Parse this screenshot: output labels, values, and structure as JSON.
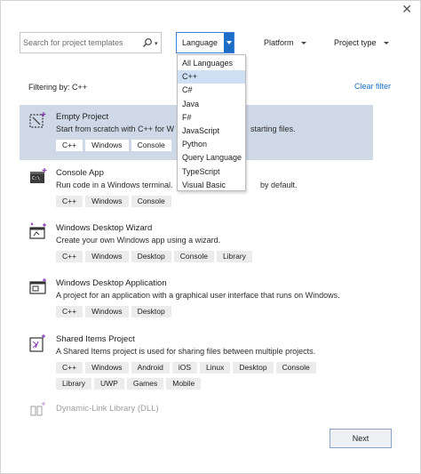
{
  "window": {
    "close_glyph": "✕"
  },
  "search": {
    "placeholder": "Search for project templates",
    "value": ""
  },
  "filters": {
    "language_label": "Language",
    "platform_label": "Platform",
    "project_type_label": "Project type"
  },
  "filtering_text": "Filtering by: C++",
  "clear_filter": "Clear filter",
  "language_menu": {
    "options": [
      "All Languages",
      "C++",
      "C#",
      "Java",
      "F#",
      "JavaScript",
      "Python",
      "Query Language",
      "TypeScript",
      "Visual Basic"
    ],
    "highlighted": "C++"
  },
  "templates": [
    {
      "title": "Empty Project",
      "desc": "Start from scratch with C++ for W",
      "desc_tail": "starting files.",
      "tags": [
        "C++",
        "Windows",
        "Console"
      ],
      "icon": "empty-project-icon"
    },
    {
      "title": "Console App",
      "desc": "Run code in a Windows terminal.",
      "desc_tail": "by default.",
      "tags": [
        "C++",
        "Windows",
        "Console"
      ],
      "icon": "console-app-icon"
    },
    {
      "title": "Windows Desktop Wizard",
      "desc": "Create your own Windows app using a wizard.",
      "tags": [
        "C++",
        "Windows",
        "Desktop",
        "Console",
        "Library"
      ],
      "icon": "desktop-wizard-icon"
    },
    {
      "title": "Windows Desktop Application",
      "desc": "A project for an application with a graphical user interface that runs on Windows.",
      "tags": [
        "C++",
        "Windows",
        "Desktop"
      ],
      "icon": "desktop-application-icon"
    },
    {
      "title": "Shared Items Project",
      "desc": "A Shared Items project is used for sharing files between multiple projects.",
      "tags": [
        "C++",
        "Windows",
        "Android",
        "iOS",
        "Linux",
        "Desktop",
        "Console",
        "Library",
        "UWP",
        "Games",
        "Mobile"
      ],
      "icon": "shared-items-icon"
    },
    {
      "title": "Dynamic-Link Library (DLL)",
      "icon": "dll-icon"
    }
  ],
  "next_label": "Next",
  "colors": {
    "accent": "#1e6ec8",
    "selected_row": "#cfd8e6",
    "link": "#1a6fc9"
  }
}
